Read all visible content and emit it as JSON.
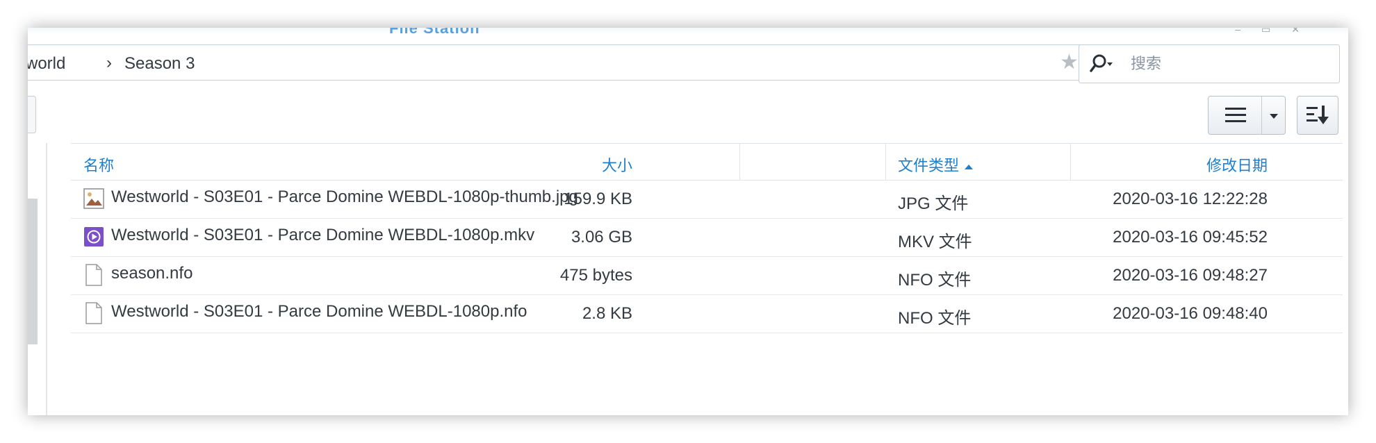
{
  "window": {
    "title": "File Station"
  },
  "path": {
    "crumbs": [
      "world",
      "Season 3"
    ],
    "separator": "›"
  },
  "search": {
    "placeholder": "搜索"
  },
  "table": {
    "columns": {
      "name": "名称",
      "size": "大小",
      "type": "文件类型",
      "modified": "修改日期"
    },
    "sorted_by": "type",
    "rows": [
      {
        "icon": "image-file-icon",
        "name": "Westworld - S03E01 - Parce Domine WEBDL-1080p-thumb.jpg",
        "size": "159.9 KB",
        "type": "JPG 文件",
        "modified": "2020-03-16 12:22:28"
      },
      {
        "icon": "video-file-icon",
        "name": "Westworld - S03E01 - Parce Domine WEBDL-1080p.mkv",
        "size": "3.06 GB",
        "type": "MKV 文件",
        "modified": "2020-03-16 09:45:52"
      },
      {
        "icon": "document-file-icon",
        "name": "season.nfo",
        "size": "475 bytes",
        "type": "NFO 文件",
        "modified": "2020-03-16 09:48:27"
      },
      {
        "icon": "document-file-icon",
        "name": "Westworld - S03E01 - Parce Domine WEBDL-1080p.nfo",
        "size": "2.8 KB",
        "type": "NFO 文件",
        "modified": "2020-03-16 09:48:40"
      }
    ]
  },
  "colors": {
    "accent": "#1e7fd0",
    "text": "#333a42",
    "border": "#c5ced8",
    "video_icon": "#7b4fc8"
  }
}
